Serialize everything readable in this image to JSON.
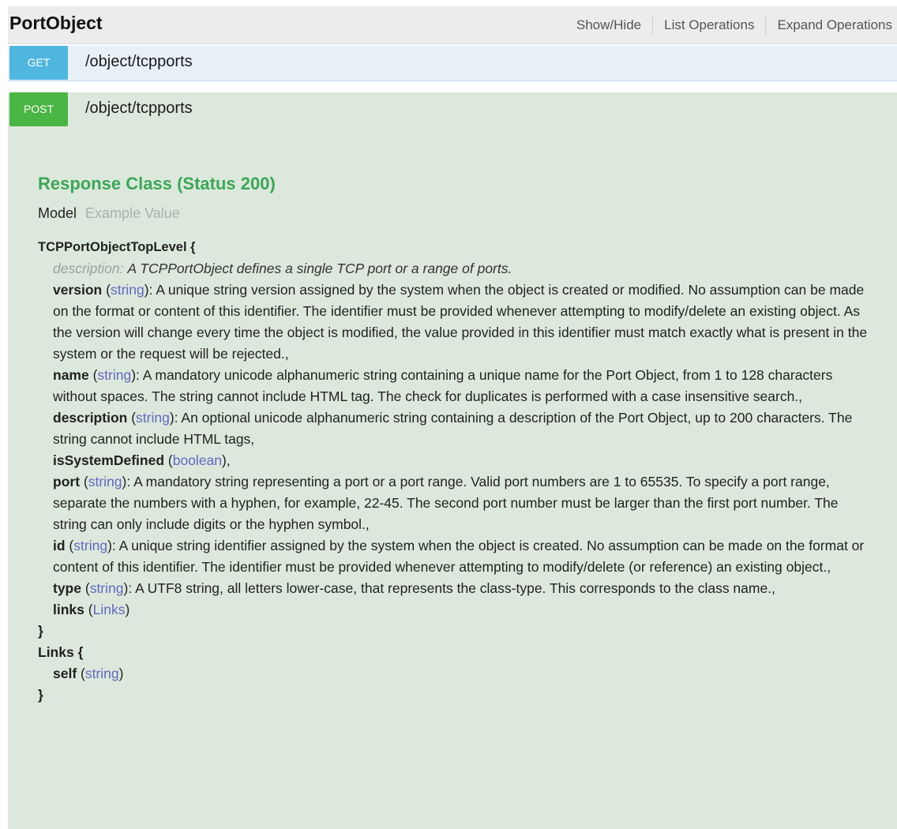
{
  "resource": {
    "title": "PortObject",
    "actions": [
      "Show/Hide",
      "List Operations",
      "Expand Operations"
    ]
  },
  "operations": [
    {
      "method": "GET",
      "path": "/object/tcpports"
    },
    {
      "method": "POST",
      "path": "/object/tcpports"
    }
  ],
  "response": {
    "title": "Response Class (Status 200)",
    "tabs": {
      "model": "Model",
      "example": "Example Value"
    }
  },
  "model": {
    "class_open": "TCPPortObjectTopLevel {",
    "description_label": "description:",
    "description_text": "A TCPPortObject defines a single TCP port or a range of ports.",
    "fields": [
      {
        "name": "version",
        "type": "string",
        "suffix": ": A unique string version assigned by the system when the object is created or modified. No assumption can be made on the format or content of this identifier. The identifier must be provided whenever attempting to modify/delete an existing object. As the version will change every time the object is modified, the value provided in this identifier must match exactly what is present in the system or the request will be rejected.,"
      },
      {
        "name": "name",
        "type": "string",
        "suffix": ": A mandatory unicode alphanumeric string containing a unique name for the Port Object, from 1 to 128 characters without spaces. The string cannot include HTML tag. The check for duplicates is performed with a case insensitive search.,"
      },
      {
        "name": "description",
        "type": "string",
        "suffix": ": An optional unicode alphanumeric string containing a description of the Port Object, up to 200 characters. The string cannot include HTML tags,"
      },
      {
        "name": "isSystemDefined",
        "type": "boolean",
        "suffix": ","
      },
      {
        "name": "port",
        "type": "string",
        "suffix": ": A mandatory string representing a port or a port range. Valid port numbers are 1 to 65535. To specify a port range, separate the numbers with a hyphen, for example, 22-45. The second port number must be larger than the first port number. The string can only include digits or the hyphen symbol.,"
      },
      {
        "name": "id",
        "type": "string",
        "suffix": ": A unique string identifier assigned by the system when the object is created. No assumption can be made on the format or content of this identifier. The identifier must be provided whenever attempting to modify/delete (or reference) an existing object.,"
      },
      {
        "name": "type",
        "type": "string",
        "suffix": ": A UTF8 string, all letters lower-case, that represents the class-type. This corresponds to the class name.,"
      },
      {
        "name": "links",
        "type": "Links",
        "suffix": ""
      }
    ],
    "class_close": "}",
    "links_open": "Links {",
    "links_field": {
      "name": "self",
      "type": "string"
    },
    "links_close": "}"
  }
}
